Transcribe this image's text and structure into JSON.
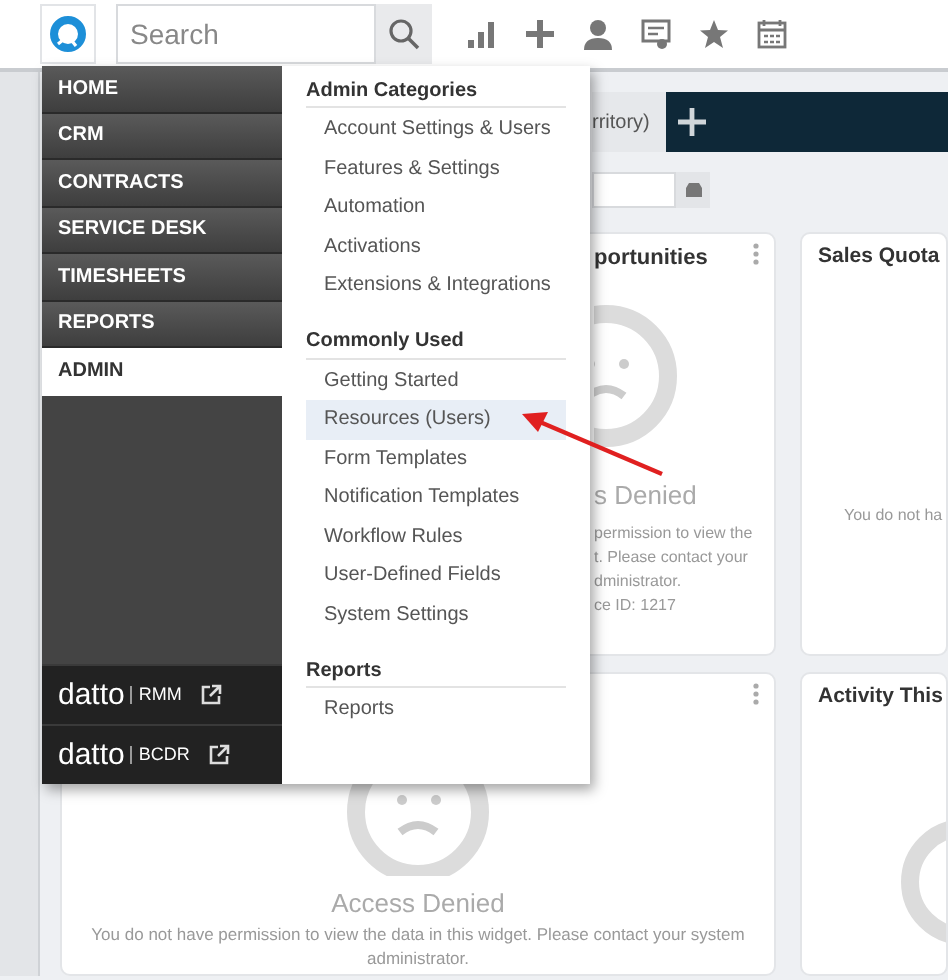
{
  "top_bar": {
    "search": {
      "placeholder": "Search"
    }
  },
  "nav_menu": {
    "items": [
      {
        "label": "HOME",
        "selected": false
      },
      {
        "label": "CRM",
        "selected": false
      },
      {
        "label": "CONTRACTS",
        "selected": false
      },
      {
        "label": "SERVICE DESK",
        "selected": false
      },
      {
        "label": "TIMESHEETS",
        "selected": false
      },
      {
        "label": "REPORTS",
        "selected": false
      },
      {
        "label": "ADMIN",
        "selected": true
      }
    ],
    "links": [
      {
        "brand": "datto",
        "product": "RMM"
      },
      {
        "brand": "datto",
        "product": "BCDR"
      }
    ]
  },
  "admin_menu": {
    "sections": [
      {
        "heading": "Admin Categories",
        "items": [
          {
            "label": "Account Settings & Users",
            "selected": false
          },
          {
            "label": "Features & Settings",
            "selected": false
          },
          {
            "label": "Automation",
            "selected": false
          },
          {
            "label": "Activations",
            "selected": false
          },
          {
            "label": "Extensions & Integrations",
            "selected": false
          }
        ]
      },
      {
        "heading": "Commonly Used",
        "items": [
          {
            "label": "Getting Started",
            "selected": false
          },
          {
            "label": "Resources (Users)",
            "selected": true
          },
          {
            "label": "Form Templates",
            "selected": false
          },
          {
            "label": "Notification Templates",
            "selected": false
          },
          {
            "label": "Workflow Rules",
            "selected": false
          },
          {
            "label": "User-Defined Fields",
            "selected": false
          },
          {
            "label": "System Settings",
            "selected": false
          }
        ]
      },
      {
        "heading": "Reports",
        "items": [
          {
            "label": "Reports",
            "selected": false
          }
        ]
      }
    ]
  },
  "dashboard": {
    "tab": "rritory)",
    "widget_rows": [
      {
        "widgets": [
          {
            "title": "portunities",
            "message": "s Denied",
            "details": [
              "permission to view the",
              "t. Please contact your",
              "dministrator.",
              "ce ID: 1217"
            ]
          },
          {
            "title": "Sales Quota",
            "details": [
              "You do not ha"
            ]
          }
        ]
      },
      {
        "widgets": [
          {
            "message": "Access Denied",
            "details": [
              "You do not have permission to view the data in this widget. Please contact your system administrator."
            ]
          },
          {
            "title": "Activity This"
          }
        ]
      }
    ]
  }
}
